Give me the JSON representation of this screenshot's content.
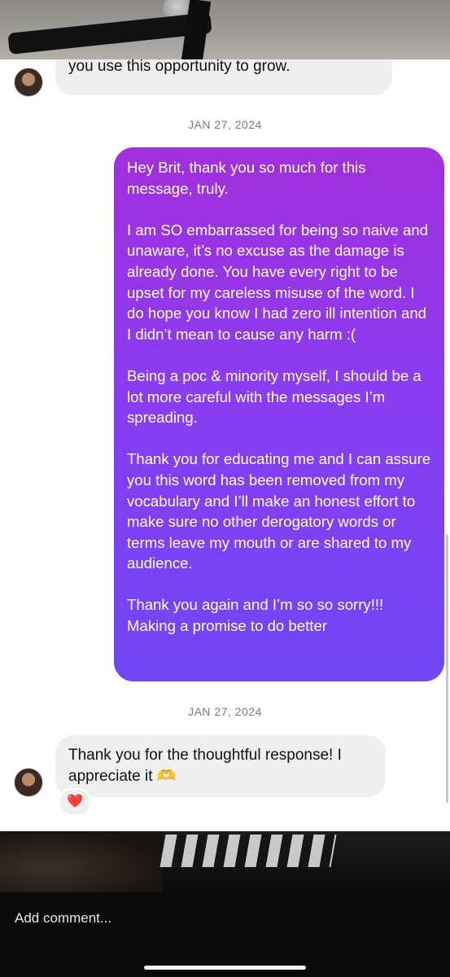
{
  "messages": {
    "previous_tail": "you use this opportunity to grow.",
    "date_1": "JAN 27, 2024",
    "outgoing_paragraphs": [
      "Hey Brit, thank you so much for this message, truly.",
      "I am SO embarrassed for being so naive and unaware, it’s no excuse as the damage is already done. You have every right to be upset for my careless misuse of the word. I do hope you know I had zero ill intention and I didn’t mean to cause any harm :(",
      "Being a poc & minority myself, I should be a lot more careful with the messages I’m spreading.",
      "Thank you for educating me and I can assure you this word has been removed from my vocabulary and I’ll make an honest effort to make sure no other derogatory words or terms leave my mouth or are shared to my audience.",
      "Thank you again and I’m so so sorry!!! Making a promise to do better"
    ],
    "date_2": "JAN 27, 2024",
    "reply": "Thank you for the thoughtful response! I appreciate it 🫶",
    "reaction": "❤️"
  },
  "comment": {
    "placeholder": "Add comment..."
  },
  "colors": {
    "outgoing_top": "#a22fdc",
    "outgoing_bottom": "#7046f5",
    "incoming": "#efefef"
  },
  "icons": {
    "avatar": "profile-photo",
    "reaction": "heart"
  }
}
